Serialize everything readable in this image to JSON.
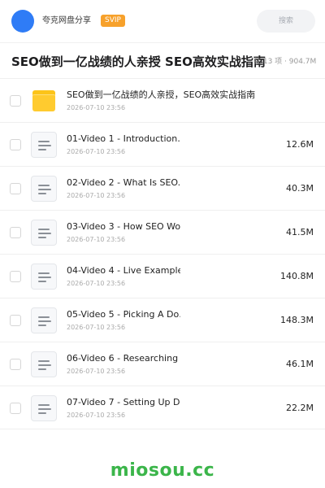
{
  "header": {
    "user_name": "夸克网盘分享",
    "badge": "SVIP",
    "search_placeholder": "搜索",
    "avatar_color": "#2f7cf6",
    "badge_color": "#f7a12b"
  },
  "page": {
    "title": "SEO做到一亿战绩的人亲授 SEO高效实战指南",
    "summary": "共 13 项 · 904.7M"
  },
  "files": [
    {
      "type": "folder",
      "icon": "folder-icon",
      "name": "SEO做到一亿战绩的人亲授，SEO高效实战指南",
      "date": "2026-07-10 23:56",
      "size": ""
    },
    {
      "type": "file",
      "icon": "document-icon",
      "name": "01-Video 1 - Introduction…",
      "date": "2026-07-10 23:56",
      "size": "12.6M"
    },
    {
      "type": "file",
      "icon": "document-icon",
      "name": "02-Video 2 - What Is SEO.…",
      "date": "2026-07-10 23:56",
      "size": "40.3M"
    },
    {
      "type": "file",
      "icon": "document-icon",
      "name": "03-Video 3 - How SEO Work…",
      "date": "2026-07-10 23:56",
      "size": "41.5M"
    },
    {
      "type": "file",
      "icon": "document-icon",
      "name": "04-Video 4 - Live Example…",
      "date": "2026-07-10 23:56",
      "size": "140.8M"
    },
    {
      "type": "file",
      "icon": "document-icon",
      "name": "05-Video 5 - Picking A Do…",
      "date": "2026-07-10 23:56",
      "size": "148.3M"
    },
    {
      "type": "file",
      "icon": "document-icon",
      "name": "06-Video 6 - Researching …",
      "date": "2026-07-10 23:56",
      "size": "46.1M"
    },
    {
      "type": "file",
      "icon": "document-icon",
      "name": "07-Video 7 - Setting Up D…",
      "date": "2026-07-10 23:56",
      "size": "22.2M"
    }
  ],
  "watermark": "miosou.cc"
}
